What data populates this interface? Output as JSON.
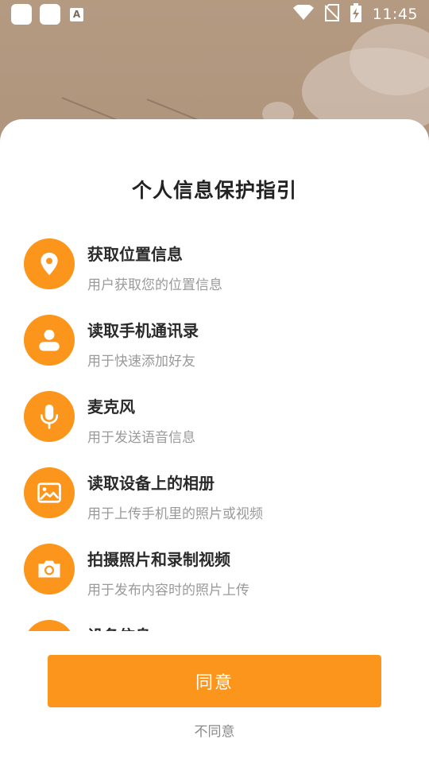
{
  "status_bar": {
    "time": "11:45",
    "icons": [
      "app-notification-icon",
      "app-notification-icon",
      "font-a-icon",
      "wifi-icon",
      "no-sim-icon",
      "battery-charging-icon"
    ]
  },
  "dialog": {
    "title": "个人信息保护指引",
    "permissions": [
      {
        "icon": "location-pin-icon",
        "title": "获取位置信息",
        "desc": "用户获取您的位置信息"
      },
      {
        "icon": "contact-person-icon",
        "title": "读取手机通讯录",
        "desc": "用于快速添加好友"
      },
      {
        "icon": "microphone-icon",
        "title": "麦克风",
        "desc": "用于发送语音信息"
      },
      {
        "icon": "image-album-icon",
        "title": "读取设备上的相册",
        "desc": "用于上传手机里的照片或视频"
      },
      {
        "icon": "camera-icon",
        "title": "拍摄照片和录制视频",
        "desc": "用于发布内容时的照片上传"
      },
      {
        "icon": "device-info-icon",
        "title": "设备信息",
        "desc": ""
      }
    ],
    "agree_label": "同意",
    "disagree_label": "不同意"
  },
  "colors": {
    "accent": "#fb951b",
    "background": "#a48a72",
    "title_text": "#222222",
    "desc_text": "#9a9a9a"
  }
}
